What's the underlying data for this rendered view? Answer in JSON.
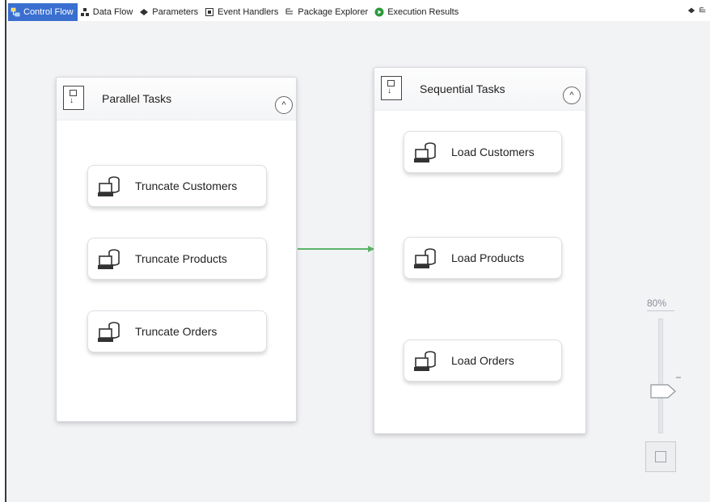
{
  "tabs": [
    {
      "label": "Control Flow",
      "icon": "control-flow-icon",
      "active": true
    },
    {
      "label": "Data Flow",
      "icon": "data-flow-icon"
    },
    {
      "label": "Parameters",
      "icon": "parameters-icon"
    },
    {
      "label": "Event Handlers",
      "icon": "event-handlers-icon"
    },
    {
      "label": "Package Explorer",
      "icon": "package-explorer-icon"
    },
    {
      "label": "Execution Results",
      "icon": "execution-results-icon"
    }
  ],
  "containers": {
    "parallel": {
      "title": "Parallel Tasks",
      "tasks": [
        "Truncate Customers",
        "Truncate Products",
        "Truncate Orders"
      ]
    },
    "sequential": {
      "title": "Sequential Tasks",
      "tasks": [
        "Load Customers",
        "Load Products",
        "Load Orders"
      ]
    }
  },
  "zoom": {
    "label": "80%",
    "level": 0.8
  },
  "colors": {
    "accent": "#3a6fd0",
    "connector": "#5cb46a"
  }
}
